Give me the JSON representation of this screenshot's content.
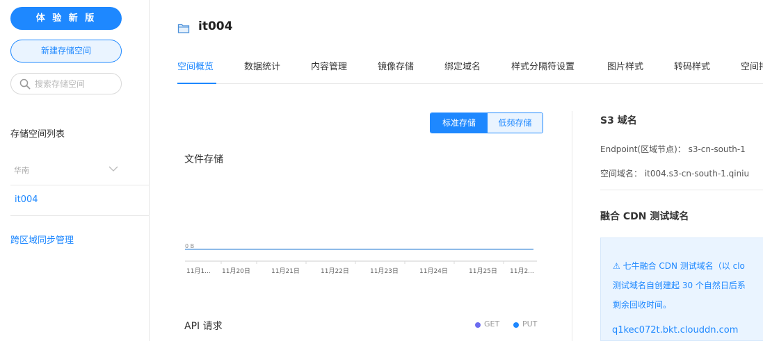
{
  "sidebar": {
    "try_new_label": "体 验 新 版",
    "new_bucket_label": "新建存储空间",
    "search_placeholder": "搜索存储空间",
    "list_title": "存储空间列表",
    "region": "华南",
    "bucket_item": "it004",
    "cross_region_link": "跨区域同步管理"
  },
  "header": {
    "bucket_name": "it004"
  },
  "tabs": [
    {
      "label": "空间概览",
      "active": true
    },
    {
      "label": "数据统计",
      "active": false
    },
    {
      "label": "内容管理",
      "active": false
    },
    {
      "label": "镜像存储",
      "active": false
    },
    {
      "label": "绑定域名",
      "active": false
    },
    {
      "label": "样式分隔符设置",
      "active": false
    },
    {
      "label": "图片样式",
      "active": false
    },
    {
      "label": "转码样式",
      "active": false
    },
    {
      "label": "空间持",
      "active": false
    }
  ],
  "storage_toggle": {
    "standard_label": "标准存储",
    "low_freq_label": "低频存储",
    "selected": "标准存储"
  },
  "file_storage": {
    "title": "文件存储"
  },
  "chart_data": {
    "type": "line",
    "title": "文件存储",
    "x": [
      "11月1...",
      "11月20日",
      "11月21日",
      "11月22日",
      "11月23日",
      "11月24日",
      "11月25日",
      "11月2..."
    ],
    "series": [
      {
        "values": [
          0,
          0,
          0,
          0,
          0,
          0,
          0,
          0
        ]
      }
    ],
    "y_tick_labels": [
      "0 B"
    ],
    "ylim": [
      0,
      1
    ],
    "grid": false,
    "line_color": "#4a90d9"
  },
  "api": {
    "title": "API 请求",
    "legend": [
      {
        "label": "GET",
        "color": "#6c6cf0"
      },
      {
        "label": "PUT",
        "color": "#1e88ff"
      }
    ]
  },
  "s3": {
    "title": "S3 域名",
    "endpoint": "Endpoint(区域节点)： s3-cn-south-1",
    "bucket_domain": "空间域名： it004.s3-cn-south-1.qiniu"
  },
  "cdn": {
    "title": "融合 CDN 测试域名",
    "notice_lines": [
      "⚠ 七牛融合 CDN 测试域名（以 clo",
      "测试域名自创建起 30 个自然日后系",
      "剩余回收时间。"
    ],
    "test_domain": "q1kec072t.bkt.clouddn.com"
  },
  "colors": {
    "accent": "#1e88ff",
    "accent_light": "#eaf4ff"
  }
}
